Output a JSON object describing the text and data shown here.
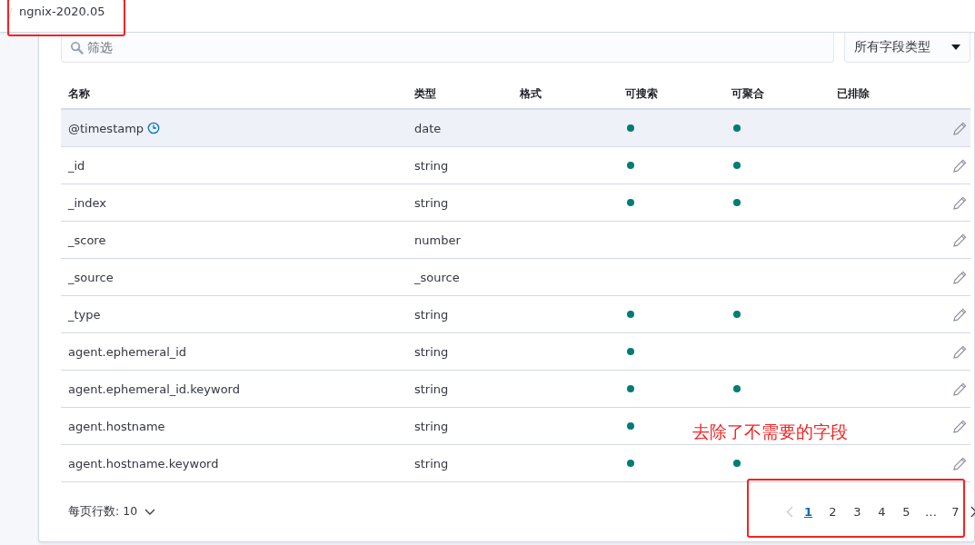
{
  "breadcrumb": {
    "current": "ngnix-2020.05"
  },
  "filter": {
    "placeholder": "筛选"
  },
  "type_filter": {
    "label": "所有字段类型"
  },
  "table": {
    "columns": [
      "名称",
      "类型",
      "格式",
      "可搜索",
      "可聚合",
      "已排除"
    ],
    "rows": [
      {
        "name": "@timestamp",
        "time_field": true,
        "type": "date",
        "searchable": true,
        "aggregatable": true,
        "highlighted": true
      },
      {
        "name": "_id",
        "time_field": false,
        "type": "string",
        "searchable": true,
        "aggregatable": true,
        "highlighted": false
      },
      {
        "name": "_index",
        "time_field": false,
        "type": "string",
        "searchable": true,
        "aggregatable": true,
        "highlighted": false
      },
      {
        "name": "_score",
        "time_field": false,
        "type": "number",
        "searchable": false,
        "aggregatable": false,
        "highlighted": false
      },
      {
        "name": "_source",
        "time_field": false,
        "type": "_source",
        "searchable": false,
        "aggregatable": false,
        "highlighted": false
      },
      {
        "name": "_type",
        "time_field": false,
        "type": "string",
        "searchable": true,
        "aggregatable": true,
        "highlighted": false
      },
      {
        "name": "agent.ephemeral_id",
        "time_field": false,
        "type": "string",
        "searchable": true,
        "aggregatable": false,
        "highlighted": false
      },
      {
        "name": "agent.ephemeral_id.keyword",
        "time_field": false,
        "type": "string",
        "searchable": true,
        "aggregatable": true,
        "highlighted": false
      },
      {
        "name": "agent.hostname",
        "time_field": false,
        "type": "string",
        "searchable": true,
        "aggregatable": false,
        "highlighted": false
      },
      {
        "name": "agent.hostname.keyword",
        "time_field": false,
        "type": "string",
        "searchable": true,
        "aggregatable": true,
        "highlighted": false
      }
    ]
  },
  "rows_per_page": {
    "label": "每页行数: 10"
  },
  "pagination": {
    "pages": [
      {
        "label": "1",
        "selected": true
      },
      {
        "label": "2",
        "selected": false
      },
      {
        "label": "3",
        "selected": false
      },
      {
        "label": "4",
        "selected": false
      },
      {
        "label": "5",
        "selected": false
      },
      {
        "label": "…",
        "selected": false
      },
      {
        "label": "7",
        "selected": false
      }
    ]
  },
  "annotation": {
    "text": "去除了不需要的字段"
  }
}
